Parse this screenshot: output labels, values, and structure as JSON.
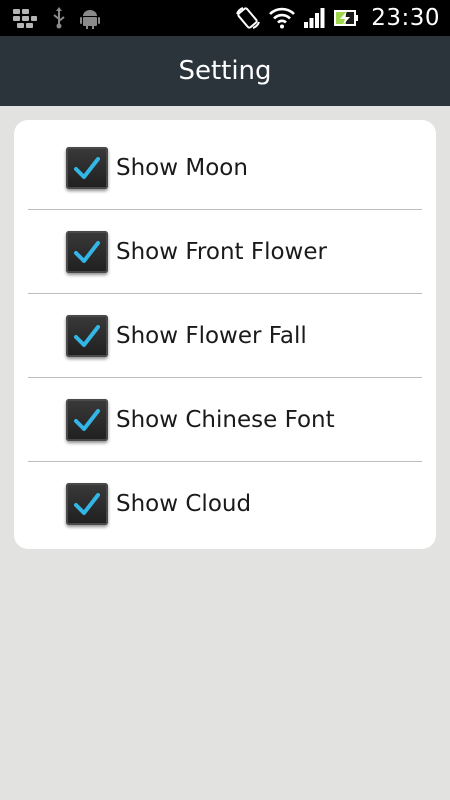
{
  "status_bar": {
    "time": "23:30",
    "icons": [
      "bbm-icon",
      "usb-icon",
      "android-debug-icon",
      "rotation-icon",
      "wifi-icon",
      "signal-icon",
      "battery-charging-icon"
    ]
  },
  "header": {
    "title": "Setting"
  },
  "settings": {
    "items": [
      {
        "label": "Show Moon",
        "checked": true
      },
      {
        "label": "Show Front Flower",
        "checked": true
      },
      {
        "label": "Show Flower Fall",
        "checked": true
      },
      {
        "label": "Show Chinese Font",
        "checked": true
      },
      {
        "label": "Show Cloud",
        "checked": true
      }
    ]
  },
  "colors": {
    "title_bar": "#2b333b",
    "background": "#e2e2e0",
    "check_accent": "#33b5e5"
  }
}
